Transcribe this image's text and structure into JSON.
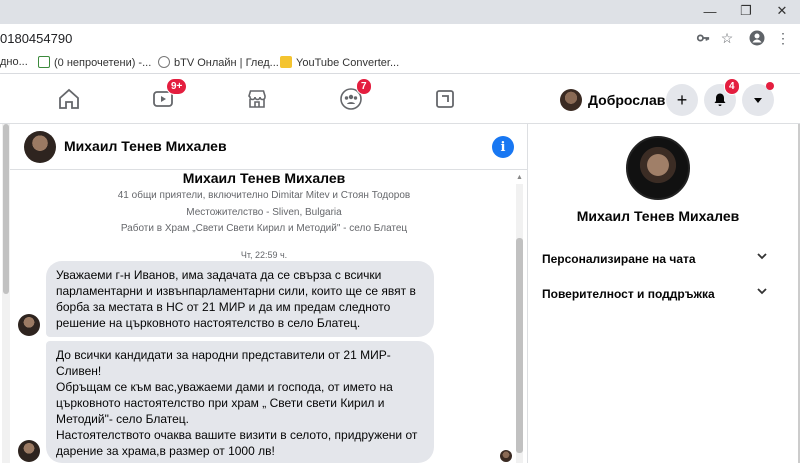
{
  "browser": {
    "url": "0180454790",
    "window_controls": [
      "—",
      "❐",
      "✕"
    ]
  },
  "bookmarks": [
    {
      "label": "дно..."
    },
    {
      "label": "(0 непрочетени) -..."
    },
    {
      "label": "bTV Онлайн | Глед..."
    },
    {
      "label": "YouTube Converter..."
    }
  ],
  "fbnav": {
    "watch_badge": "9+",
    "groups_badge": "7",
    "profile_name": "Доброслав",
    "notifications_badge": "4"
  },
  "chat": {
    "title": "Михаил Тенев Михалев",
    "intro_name": "Михаил Тенев Михалев",
    "intro_lines": [
      "41 общи приятели, включително Dimitar Mitev и Стоян Тодоров",
      "Местожителство - Sliven, Bulgaria",
      "Работи в Храм „Свети Свети Кирил и Методий\" - село Блатец"
    ],
    "timestamp": "Чт, 22:59 ч.",
    "message1": [
      "Уважаеми г-н Иванов, има задачата да се свърза с всички",
      "парламентарни и извънпарламентарни сили, които ще се явят в",
      "борба за местата в НС от 21 МИР и да им предам следното",
      "решение на църковното настоятелство в село Блатец."
    ],
    "message2": [
      "До всички кандидати за народни представители от 21 МИР-",
      "Сливен!",
      "Обръщам се към вас,уважаеми дами и господа, от името на",
      "църковното настоятелство при храм „ Свети свети Кирил и",
      "Методий\"- село Блатец.",
      "Настоятелството очаква вашите визити в селото, придружени от",
      "дарение за храма,в размер от 1000 лв!"
    ]
  },
  "panel": {
    "name": "Михаил Тенев Михалев",
    "row1": "Персонализиране на чата",
    "row2": "Поверителност и поддръжка"
  }
}
